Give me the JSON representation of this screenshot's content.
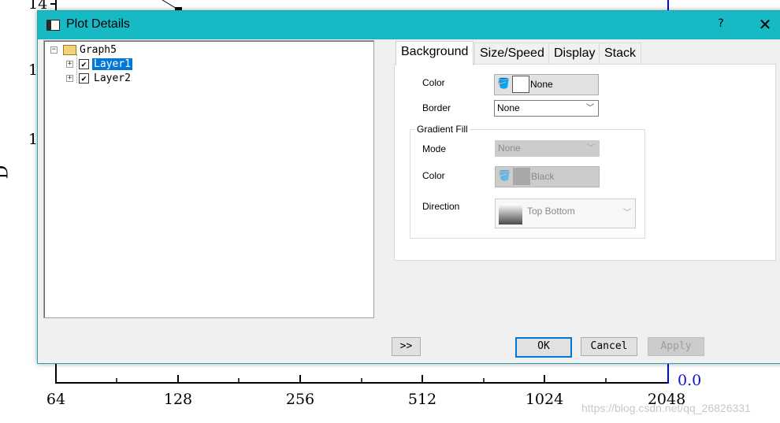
{
  "graph": {
    "x_ticks": [
      "64",
      "128",
      "256",
      "512",
      "1024",
      "2048"
    ],
    "y_ticks_visible": [
      "14",
      "1",
      "1"
    ],
    "y_axis_label": "D",
    "y2_tick": "0.0",
    "axis_color_right": "#0000ff"
  },
  "watermark": "https://blog.csdn.net/qq_26826331",
  "dialog": {
    "title": "Plot Details",
    "help_label": "?",
    "close_label": "✕",
    "titlebar_color": "#16b9c4",
    "tree": {
      "root": {
        "label": "Graph5",
        "expander": "−",
        "icon": "folder-icon"
      },
      "children": [
        {
          "label": "Layer1",
          "expander": "+",
          "checked": "✔",
          "selected": true
        },
        {
          "label": "Layer2",
          "expander": "+",
          "checked": "✔",
          "selected": false
        }
      ]
    },
    "tabs": [
      "Background",
      "Size/Speed",
      "Display",
      "Stack"
    ],
    "active_tab": "Background",
    "background_tab": {
      "color_label": "Color",
      "color_value": "None",
      "border_label": "Border",
      "border_value": "None",
      "gradient_group": "Gradient Fill",
      "mode_label": "Mode",
      "mode_value": "None",
      "gradient_color_label": "Color",
      "gradient_color_value": "Black",
      "direction_label": "Direction",
      "direction_value": "Top Bottom"
    },
    "footer": {
      "expand_label": ">>",
      "ok_label": "OK",
      "cancel_label": "Cancel",
      "apply_label": "Apply"
    }
  }
}
